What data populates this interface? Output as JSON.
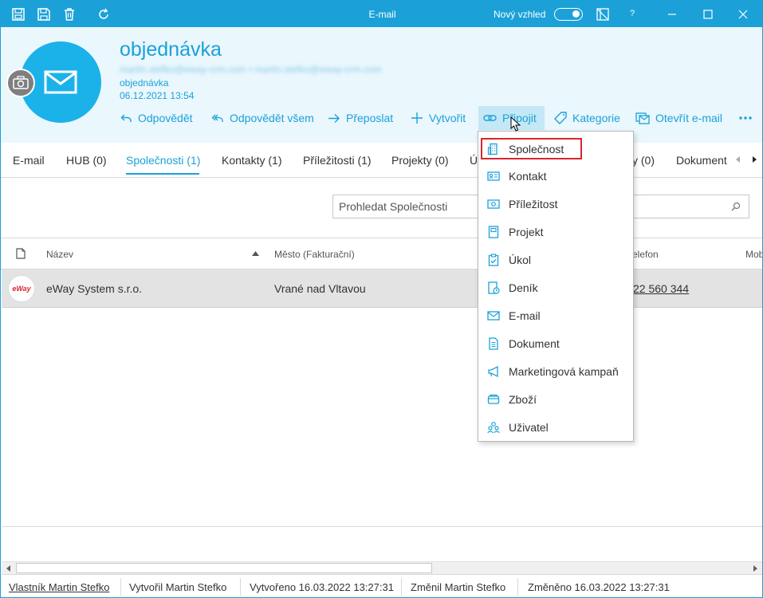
{
  "window": {
    "title": "E-mail",
    "new_look_label": "Nový vzhled",
    "help_label": "?"
  },
  "header": {
    "subject": "objednávka",
    "recipients": "martin.stefko@eway-crm.com • martin.stefko@eway-crm.com",
    "type_line": "objednávka",
    "date": "06.12.2021 13:54"
  },
  "actions": {
    "reply": "Odpovědět",
    "reply_all": "Odpovědět všem",
    "forward": "Přeposlat",
    "create": "Vytvořit",
    "attach": "Připojit",
    "category": "Kategorie",
    "open_email": "Otevřít e-mail"
  },
  "tabs": [
    {
      "label": "E-mail"
    },
    {
      "label": "HUB (0)"
    },
    {
      "label": "Společnosti (1)"
    },
    {
      "label": "Kontakty (1)"
    },
    {
      "label": "Příležitosti (1)"
    },
    {
      "label": "Projekty (0)"
    },
    {
      "label": "Ú"
    },
    {
      "label": "y (0)"
    },
    {
      "label": "Dokument"
    }
  ],
  "search": {
    "placeholder": "Prohledat Společnosti"
  },
  "grid": {
    "columns": [
      "Název",
      "Město (Fakturační)",
      "elefon",
      "Mob"
    ],
    "rows": [
      {
        "name": "eWay System s.r.o.",
        "city": "Vrané nad Vltavou",
        "phone": "22 560 344",
        "logo_text": "eWay"
      }
    ]
  },
  "footer": {
    "owner": "Vlastník Martin Stefko",
    "created_by": "Vytvořil Martin Stefko",
    "created_at": "Vytvořeno 16.03.2022 13:27:31",
    "changed_by": "Změnil Martin Stefko",
    "changed_at": "Změněno 16.03.2022 13:27:31"
  },
  "menu": {
    "items": [
      {
        "label": "Společnost",
        "icon": "building-icon"
      },
      {
        "label": "Kontakt",
        "icon": "contact-card-icon"
      },
      {
        "label": "Příležitost",
        "icon": "money-icon"
      },
      {
        "label": "Projekt",
        "icon": "project-book-icon"
      },
      {
        "label": "Úkol",
        "icon": "clipboard-check-icon"
      },
      {
        "label": "Deník",
        "icon": "journal-clock-icon"
      },
      {
        "label": "E-mail",
        "icon": "envelope-icon"
      },
      {
        "label": "Dokument",
        "icon": "document-icon"
      },
      {
        "label": "Marketingová kampaň",
        "icon": "megaphone-icon"
      },
      {
        "label": "Zboží",
        "icon": "goods-icon"
      },
      {
        "label": "Uživatel",
        "icon": "users-icon"
      }
    ]
  },
  "colors": {
    "accent": "#1ba1d8",
    "header_bg": "#eaf7fd",
    "highlight_red": "#d9262e",
    "row_selected": "#e3e3e3"
  }
}
